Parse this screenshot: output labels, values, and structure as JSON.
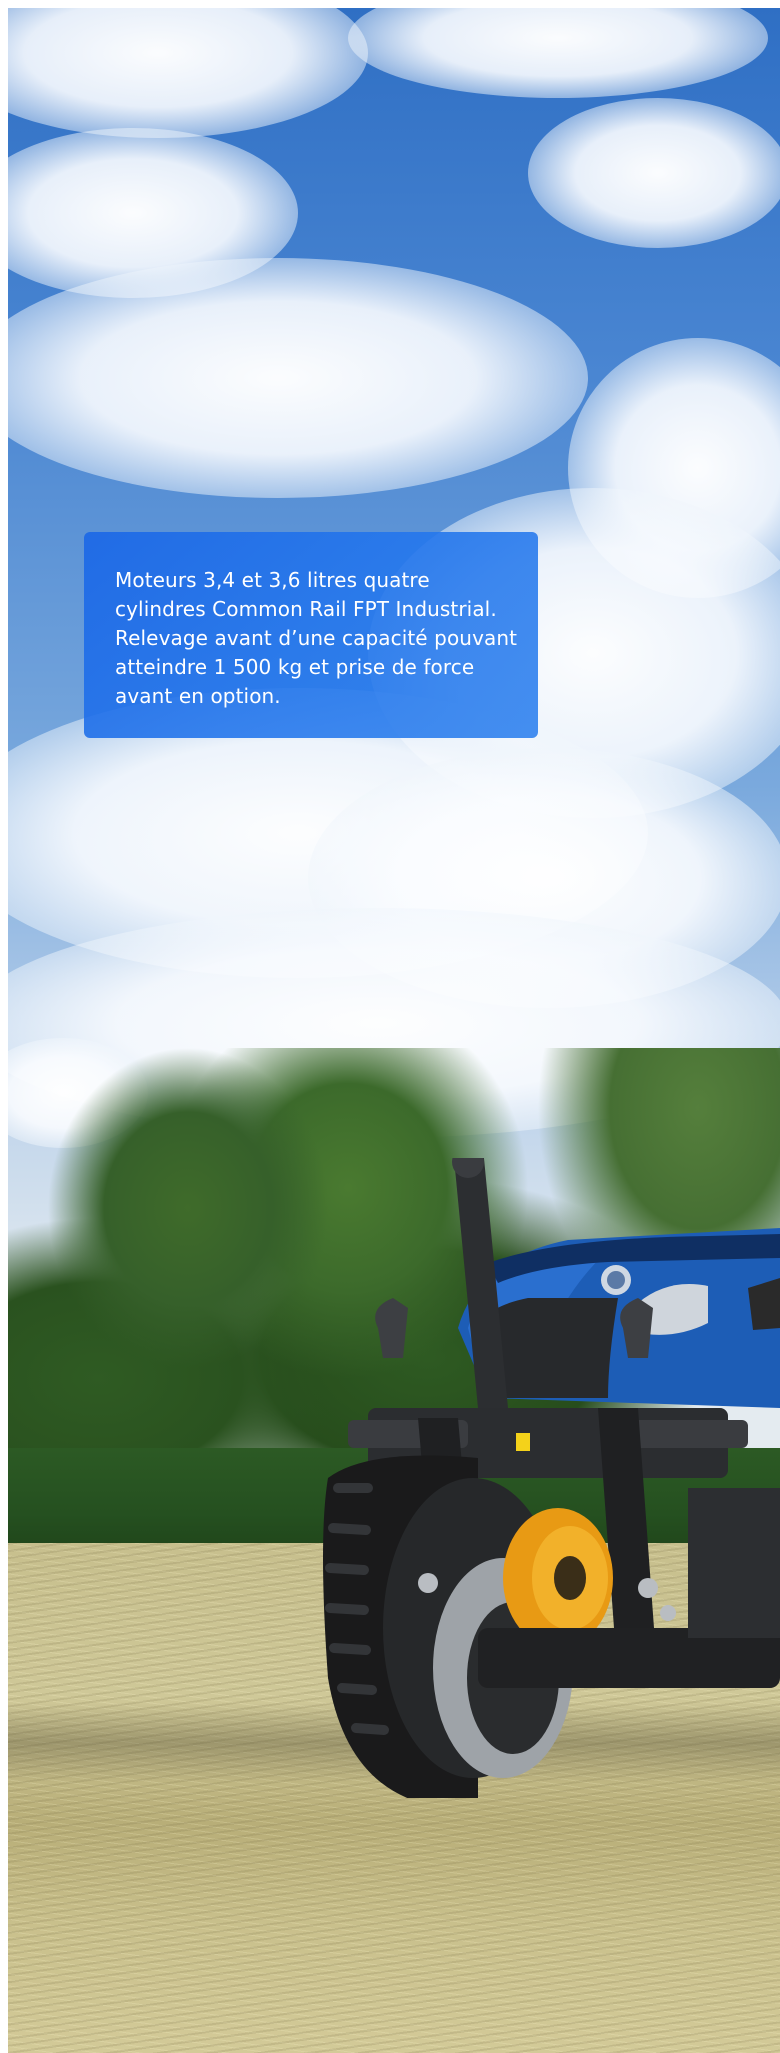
{
  "caption": {
    "line1": "Moteurs 3,4 et 3,6 litres quatre",
    "line2": "cylindres Common Rail FPT Industrial.",
    "line3": "Relevage avant d’une capacité pouvant",
    "line4": "atteindre 1 500 kg et prise de force",
    "line5": "avant en option."
  },
  "colors": {
    "caption_background": "#1f6ce6",
    "caption_text": "#ffffff",
    "sky": "#2f6fc4",
    "tractor_blue": "#1f5fb8",
    "pto_cover": "#f0a21c"
  }
}
